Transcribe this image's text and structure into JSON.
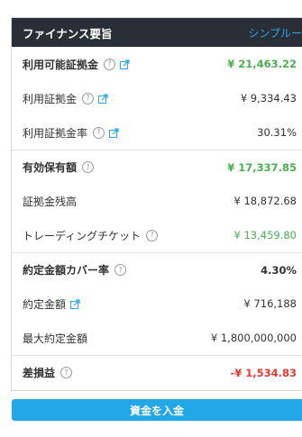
{
  "header": {
    "title": "ファイナンス要旨",
    "mode_link": "シンプルー"
  },
  "rows": [
    {
      "label": "利用可能証拠金",
      "value": "¥ 21,463.22",
      "color": "green",
      "bold": true,
      "help": true,
      "ext": true
    },
    {
      "label": "利用証拠金",
      "value": "¥ 9,334.43",
      "help": true,
      "ext": true
    },
    {
      "label": "利用証拠金率",
      "value": "30.31%",
      "help": true,
      "ext": true
    },
    {
      "label": "有効保有額",
      "value": "¥ 17,337.85",
      "color": "green",
      "bold": true,
      "help": true
    },
    {
      "label": "証拠金残高",
      "value": "¥ 18,872.68"
    },
    {
      "label": "トレーディングチケット",
      "value": "¥ 13,459.80",
      "color": "green",
      "help": true
    },
    {
      "label": "約定金額カバー率",
      "value": "4.30%",
      "bold": true,
      "help": true
    },
    {
      "label": "約定金額",
      "value": "¥ 716,188",
      "ext": true
    },
    {
      "label": "最大約定金額",
      "value": "¥ 1,800,000,000"
    },
    {
      "label": "差損益",
      "value": "-¥ 1,534.83",
      "color": "red",
      "bold": true,
      "help": true
    }
  ],
  "help_glyph": "?",
  "deposit_button": "資金を入金"
}
